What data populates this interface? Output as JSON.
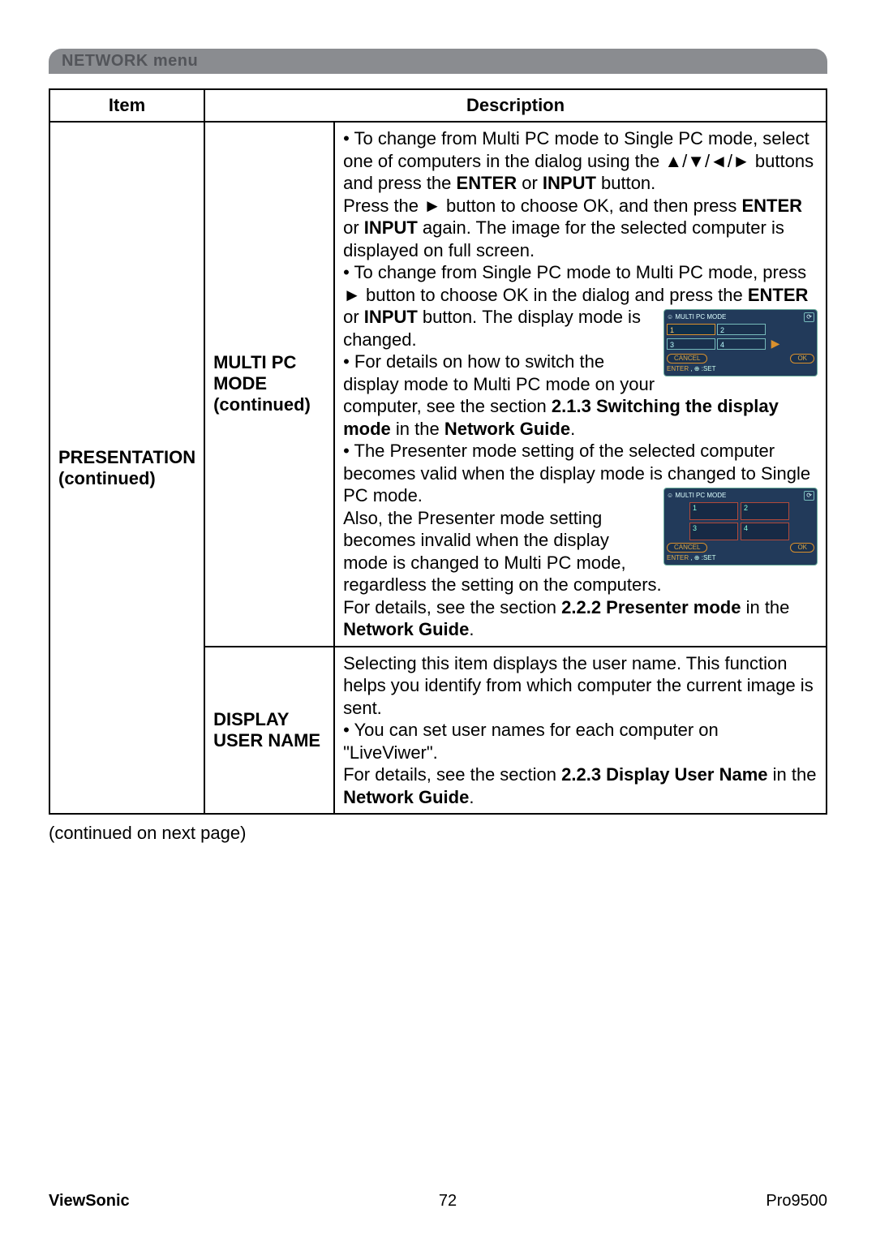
{
  "section_title": "NETWORK menu",
  "table": {
    "headers": {
      "item": "Item",
      "description": "Description"
    },
    "col_item": {
      "line1": "PRESENTATION",
      "line2": "(continued)"
    },
    "row1": {
      "sub": {
        "line1": "MULTI PC",
        "line2": "MODE",
        "line3": "(continued)"
      },
      "desc": {
        "p1_a": "• To change from Multi PC mode to Single PC mode, select one of computers in the dialog using the ",
        "p1_arrows": "▲/▼/◄/►",
        "p1_b": " buttons and press the ",
        "p1_enter": "ENTER",
        "p1_or": " or ",
        "p1_input": "INPUT",
        "p1_c": " button.",
        "p2_a": "Press the ",
        "p2_arrow": "►",
        "p2_b": " button to choose OK, and then press ",
        "p2_enter": "ENTER",
        "p2_or": " or ",
        "p2_input": "INPUT",
        "p2_c": " again. The image for the selected computer is displayed on full screen.",
        "p3_a": "• To change from Single PC mode to Multi PC mode, press ",
        "p3_arrow": "►",
        "p3_b": " button to choose OK in the dialog and press the ",
        "p3_enter": "ENTER",
        "p3_or": " or ",
        "p3_input": "INPUT",
        "p3_c": " button.",
        "p4": "The display mode is changed.",
        "p5_a": "• For details on how to switch the display mode to Multi PC mode on your computer, see the section ",
        "p5_b": "2.1.3 Switching the display mode",
        "p5_c": " in the ",
        "p5_d": "Network Guide",
        "p5_e": ".",
        "p6": "• The Presenter mode setting of the selected computer becomes valid when the display mode is changed to Single PC mode.",
        "p7": "Also, the Presenter mode setting becomes invalid when the display mode is changed to Multi PC mode, regardless the setting on the computers.",
        "p8_a": "For details, see the section ",
        "p8_b": "2.2.2 Presenter mode",
        "p8_c": " in the ",
        "p8_d": "Network Guide",
        "p8_e": "."
      }
    },
    "row2": {
      "sub": {
        "line1": "DISPLAY",
        "line2": "USER NAME"
      },
      "desc": {
        "p1": "Selecting this item displays the user name. This function helps you identify from which computer the current image is sent.",
        "p2": "• You can set user names for each computer on \"LiveViwer\".",
        "p3_a": "For details, see the section ",
        "p3_b": "2.2.3 Display User Name",
        "p3_c": " in the ",
        "p3_d": "Network Guide",
        "p3_e": "."
      }
    }
  },
  "dialog": {
    "title": "MULTI PC MODE",
    "cells": [
      "1",
      "2",
      "3",
      "4"
    ],
    "cancel": "CANCEL",
    "ok": "OK",
    "hint_enter": "ENTER",
    "hint_set": ":SET"
  },
  "continued_text": "(continued on next page)",
  "footer": {
    "brand": "ViewSonic",
    "page": "72",
    "model": "Pro9500"
  }
}
